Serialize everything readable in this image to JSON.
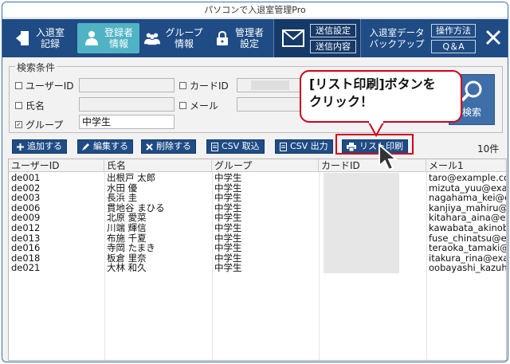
{
  "window": {
    "title": "パソコンで入退室管理Pro"
  },
  "toolbar": {
    "items": [
      {
        "label": "入退室\n記録",
        "icon": "door-exit-icon"
      },
      {
        "label": "登録者\n情報",
        "icon": "person-icon",
        "active": true
      },
      {
        "label": "グループ\n情報",
        "icon": "group-icon"
      },
      {
        "label": "管理者\n設定",
        "icon": "lock-icon"
      }
    ],
    "send_settings": "送信設定",
    "send_content": "送信内容",
    "data_backup": "入退室データ\nバックアップ",
    "how_to": "操作方法",
    "qa": "Q＆A",
    "accent": "#1f4c85",
    "active_color": "#4fb3c4"
  },
  "search": {
    "legend": "検索条件",
    "user_id_label": "ユーザーID",
    "user_id_value": "",
    "name_label": "氏名",
    "name_value": "",
    "group_label": "グループ",
    "group_value": "中学生",
    "card_id_label": "カードID",
    "email_label": "メール",
    "button_label": "検索"
  },
  "actions": {
    "add": "追加する",
    "edit": "編集する",
    "delete": "削除する",
    "csv_import": "CSV 取込",
    "csv_export": "CSV 出力",
    "print_list": "リスト印刷",
    "count": "10件"
  },
  "callout": {
    "line1": "[リスト印刷]ボタンを",
    "line2": "クリック！",
    "color": "#d0021b"
  },
  "table": {
    "headers": [
      "ユーザーID",
      "氏名",
      "グループ",
      "カードID",
      "メール1"
    ],
    "rows": [
      [
        "de001",
        "出根戸 太郎",
        "中学生",
        "",
        "taro@example.com"
      ],
      [
        "de002",
        "水田 優",
        "中学生",
        "",
        "mizuta_yuu@exam"
      ],
      [
        "de003",
        "長浜 圭",
        "中学生",
        "",
        "nagahama_kei@ex"
      ],
      [
        "de006",
        "貫地谷 まひる",
        "中学生",
        "",
        "kanjiya_mahiru@ex"
      ],
      [
        "de009",
        "北原 愛菜",
        "中学生",
        "",
        "kitahara_aina@exa"
      ],
      [
        "de012",
        "川端 輝信",
        "中学生",
        "",
        "kawabata_akinobu"
      ],
      [
        "de013",
        "布施 千夏",
        "中学生",
        "",
        "fuse_chinatsu@ex"
      ],
      [
        "de016",
        "寺岡 たまき",
        "中学生",
        "",
        "teraoka_tamaki@e"
      ],
      [
        "de018",
        "板倉 里奈",
        "中学生",
        "",
        "itakura_rina@exan"
      ],
      [
        "de021",
        "大林 和久",
        "中学生",
        "",
        "oobayashi_kazuhis"
      ]
    ]
  }
}
